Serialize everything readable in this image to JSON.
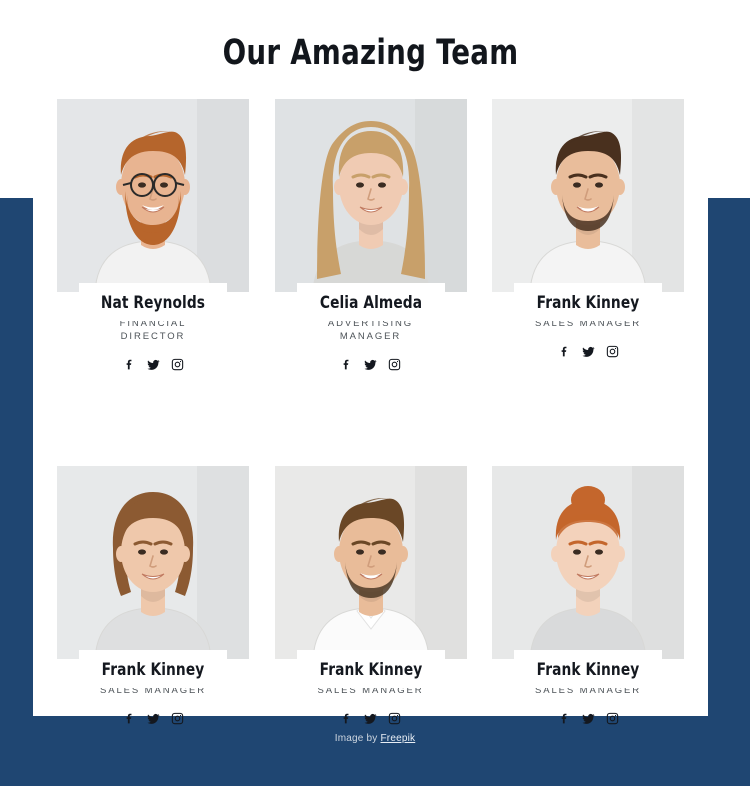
{
  "theme": {
    "accent_blue": "#1f4672",
    "sheet_white": "#ffffff",
    "text_dark": "#14181f",
    "role_gray": "#4d5358"
  },
  "header": {
    "title": "Our Amazing Team"
  },
  "team": {
    "rows": [
      {
        "members": [
          {
            "name": "Nat Reynolds",
            "role": "FINANCIAL DIRECTOR",
            "photo_alt": "bearded man with round glasses in white t-shirt",
            "socials": [
              {
                "icon": "facebook-icon",
                "label": "Facebook"
              },
              {
                "icon": "twitter-icon",
                "label": "Twitter"
              },
              {
                "icon": "instagram-icon",
                "label": "Instagram"
              }
            ]
          },
          {
            "name": "Celia Almeda",
            "role": "ADVERTISING MANAGER",
            "photo_alt": "blonde woman with long hair in gray knit sweater",
            "socials": [
              {
                "icon": "facebook-icon",
                "label": "Facebook"
              },
              {
                "icon": "twitter-icon",
                "label": "Twitter"
              },
              {
                "icon": "instagram-icon",
                "label": "Instagram"
              }
            ]
          },
          {
            "name": "Frank Kinney",
            "role": "SALES MANAGER",
            "photo_alt": "young man with dark quiff hair and short beard in white t-shirt",
            "socials": [
              {
                "icon": "facebook-icon",
                "label": "Facebook"
              },
              {
                "icon": "twitter-icon",
                "label": "Twitter"
              },
              {
                "icon": "instagram-icon",
                "label": "Instagram"
              }
            ]
          }
        ]
      },
      {
        "members": [
          {
            "name": "Frank Kinney",
            "role": "SALES MANAGER",
            "photo_alt": "woman with brown bob haircut in light gray sweatshirt",
            "socials": [
              {
                "icon": "facebook-icon",
                "label": "Facebook"
              },
              {
                "icon": "twitter-icon",
                "label": "Twitter"
              },
              {
                "icon": "instagram-icon",
                "label": "Instagram"
              }
            ]
          },
          {
            "name": "Frank Kinney",
            "role": "SALES MANAGER",
            "photo_alt": "bearded man in white collared shirt",
            "socials": [
              {
                "icon": "facebook-icon",
                "label": "Facebook"
              },
              {
                "icon": "twitter-icon",
                "label": "Twitter"
              },
              {
                "icon": "instagram-icon",
                "label": "Instagram"
              }
            ]
          },
          {
            "name": "Frank Kinney",
            "role": "SALES MANAGER",
            "photo_alt": "red haired woman with hair in a bun in gray top",
            "socials": [
              {
                "icon": "facebook-icon",
                "label": "Facebook"
              },
              {
                "icon": "twitter-icon",
                "label": "Twitter"
              },
              {
                "icon": "instagram-icon",
                "label": "Instagram"
              }
            ]
          }
        ]
      }
    ]
  },
  "footer": {
    "credit_prefix": "Image by ",
    "credit_link": "Freepik"
  }
}
